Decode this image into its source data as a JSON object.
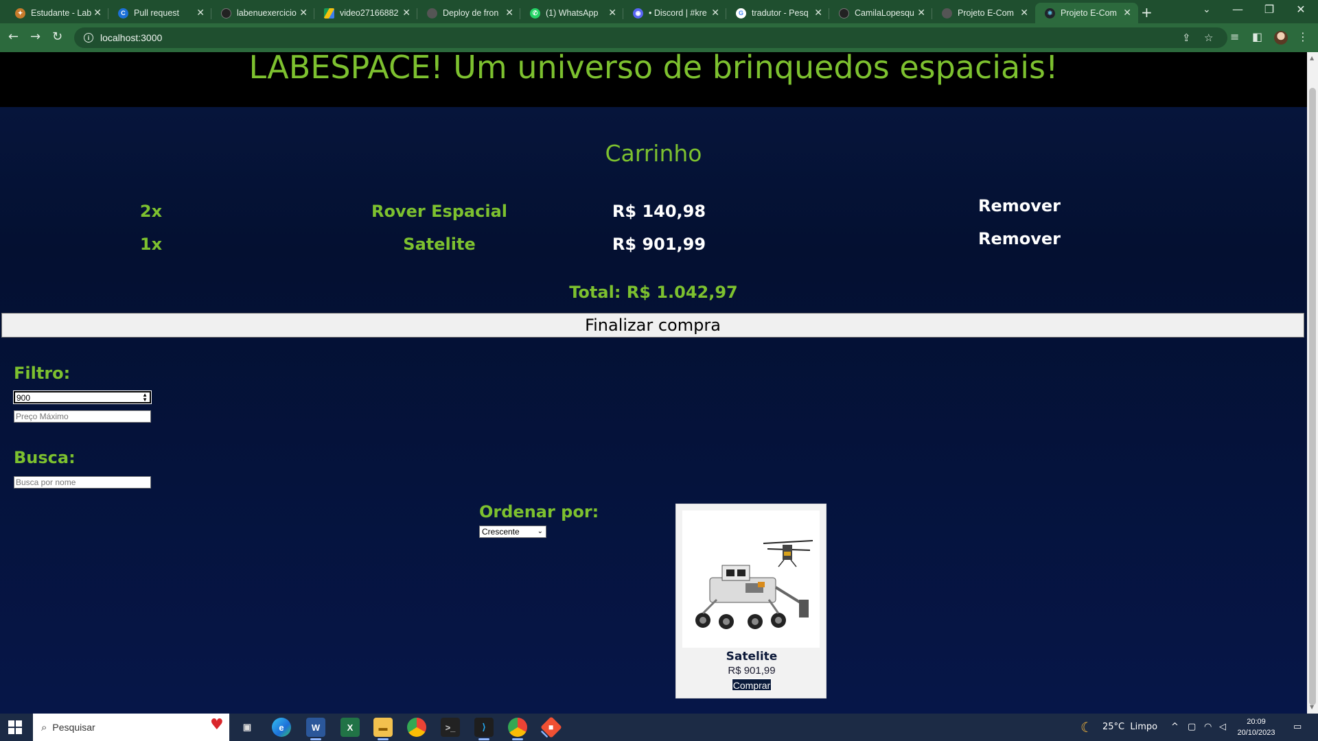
{
  "browser": {
    "tabs": [
      {
        "title": "Estudante - Lab",
        "favicon_color": "#c77b2c",
        "active": false
      },
      {
        "title": "Pull request",
        "favicon_color": "#1c70d8",
        "active": false
      },
      {
        "title": "labenuexercicio",
        "favicon_color": "#222222",
        "active": false
      },
      {
        "title": "video27166882",
        "favicon_color": "#1a9a53",
        "active": false
      },
      {
        "title": "Deploy de fron",
        "favicon_color": "#555555",
        "active": false
      },
      {
        "title": "(1) WhatsApp",
        "favicon_color": "#25d366",
        "active": false
      },
      {
        "title": "• Discord | #kre",
        "favicon_color": "#5865f2",
        "active": false
      },
      {
        "title": "tradutor - Pesq",
        "favicon_color": "#ffffff",
        "active": false
      },
      {
        "title": "CamilaLopesqu",
        "favicon_color": "#222222",
        "active": false
      },
      {
        "title": "Projeto E-Com",
        "favicon_color": "#555555",
        "active": false
      },
      {
        "title": "Projeto E-Com",
        "favicon_color": "#61dafb",
        "active": true
      }
    ],
    "url": "localhost:3000"
  },
  "page": {
    "title": "LABESPACE! Um universo de brinquedos espaciais!",
    "cart": {
      "heading": "Carrinho",
      "items": [
        {
          "qty": "2x",
          "name": "Rover Espacial",
          "price": "R$ 140,98",
          "remove_label": "Remover"
        },
        {
          "qty": "1x",
          "name": "Satelite",
          "price": "R$ 901,99",
          "remove_label": "Remover"
        }
      ],
      "total": "Total: R$ 1.042,97",
      "checkout_label": "Finalizar compra"
    },
    "filter": {
      "label": "Filtro:",
      "min_value": "900",
      "max_placeholder": "Preço Máximo"
    },
    "search": {
      "label": "Busca:",
      "placeholder": "Busca por nome"
    },
    "sort": {
      "label": "Ordenar por:",
      "selected": "Crescente"
    },
    "products": [
      {
        "name": "Satelite",
        "price": "R$ 901,99",
        "buy_label": "Comprar"
      }
    ]
  },
  "taskbar": {
    "search_placeholder": "Pesquisar",
    "apps": [
      "task-view",
      "edge",
      "word",
      "excel",
      "file-explorer",
      "chrome",
      "terminal",
      "vscode",
      "chrome-profile",
      "git"
    ],
    "weather": "25°C  Limpo",
    "time": "20:09",
    "date": "20/10/2023"
  }
}
